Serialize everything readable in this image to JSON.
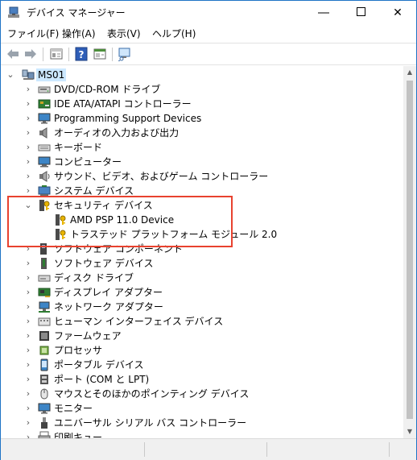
{
  "window": {
    "title": "デバイス マネージャー"
  },
  "menu": [
    "ファイル(F)",
    "操作(A)",
    "表示(V)",
    "ヘルプ(H)"
  ],
  "toolbar": [
    "back-arrow-icon",
    "forward-arrow-icon",
    "properties-icon",
    "help-icon",
    "view-icon",
    "scan-hardware-icon"
  ],
  "tree": {
    "root": "MS01",
    "items": [
      {
        "label": "DVD/CD-ROM ドライブ",
        "icon": "dvd-drive-icon",
        "expanded": false
      },
      {
        "label": "IDE ATA/ATAPI コントローラー",
        "icon": "ide-controller-icon",
        "expanded": false
      },
      {
        "label": "Programming Support Devices",
        "icon": "monitor-icon",
        "expanded": false
      },
      {
        "label": "オーディオの入力および出力",
        "icon": "speaker-icon",
        "expanded": false
      },
      {
        "label": "キーボード",
        "icon": "keyboard-icon",
        "expanded": false
      },
      {
        "label": "コンピューター",
        "icon": "computer-icon",
        "expanded": false
      },
      {
        "label": "サウンド、ビデオ、およびゲーム コントローラー",
        "icon": "sound-icon",
        "expanded": false
      },
      {
        "label": "システム デバイス",
        "icon": "system-device-icon",
        "expanded": false
      },
      {
        "label": "セキュリティ デバイス",
        "icon": "security-device-icon",
        "expanded": true,
        "children": [
          "AMD PSP 11.0 Device",
          "トラステッド プラットフォーム モジュール 2.0"
        ]
      },
      {
        "label": "ソフトウェア コンポーネント",
        "icon": "software-component-icon",
        "expanded": false
      },
      {
        "label": "ソフトウェア デバイス",
        "icon": "software-device-icon",
        "expanded": false
      },
      {
        "label": "ディスク ドライブ",
        "icon": "disk-drive-icon",
        "expanded": false
      },
      {
        "label": "ディスプレイ アダプター",
        "icon": "display-adapter-icon",
        "expanded": false
      },
      {
        "label": "ネットワーク アダプター",
        "icon": "network-adapter-icon",
        "expanded": false
      },
      {
        "label": "ヒューマン インターフェイス デバイス",
        "icon": "hid-icon",
        "expanded": false
      },
      {
        "label": "ファームウェア",
        "icon": "firmware-icon",
        "expanded": false
      },
      {
        "label": "プロセッサ",
        "icon": "processor-icon",
        "expanded": false
      },
      {
        "label": "ポータブル デバイス",
        "icon": "portable-device-icon",
        "expanded": false
      },
      {
        "label": "ポート (COM と LPT)",
        "icon": "port-icon",
        "expanded": false
      },
      {
        "label": "マウスとそのほかのポインティング デバイス",
        "icon": "mouse-icon",
        "expanded": false
      },
      {
        "label": "モニター",
        "icon": "monitor-icon",
        "expanded": false
      },
      {
        "label": "ユニバーサル シリアル バス コントローラー",
        "icon": "usb-icon",
        "expanded": false
      },
      {
        "label": "印刷キュー",
        "icon": "printer-icon",
        "expanded": false
      }
    ]
  },
  "colors": {
    "highlight_border": "#e8422f",
    "selection": "#cce8ff",
    "window_border": "#1f74c6"
  }
}
